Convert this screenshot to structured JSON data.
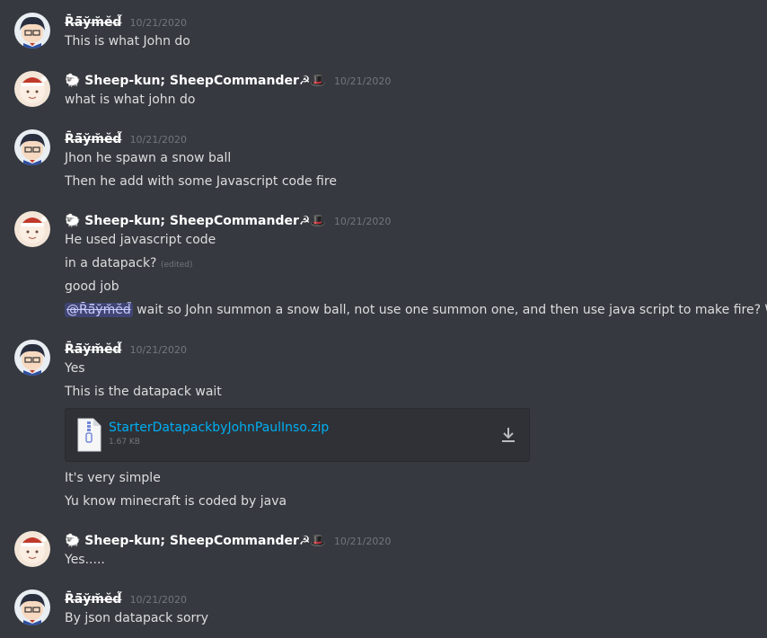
{
  "messages": [
    {
      "user": "R̄ä̃y̆m̆ĕd̃",
      "ts": "10/21/2020",
      "lines": [
        "This is what John do"
      ]
    },
    {
      "user": "🐑 Sheep-kun; SheepCommander☭🎩",
      "ts": "10/21/2020",
      "lines": [
        "what is what john do"
      ]
    },
    {
      "user": "R̄ä̃y̆m̆ĕd̃",
      "ts": "10/21/2020",
      "lines": [
        "Jhon he spawn a snow ball",
        "Then he add with some Javascript code fire"
      ]
    },
    {
      "user": "🐑 Sheep-kun; SheepCommander☭🎩",
      "ts": "10/21/2020",
      "lines": [
        "He used javascript code",
        "in a datapack?",
        "good job"
      ],
      "edited": "(edited)",
      "mention": "@R̄ä̃y̆m̆ĕd̃",
      "mention_text": " wait so John summon a snow ball, not use one summon one, and then use java script to make fire? What?"
    },
    {
      "user": "R̄ä̃y̆m̆ĕd̃",
      "ts": "10/21/2020",
      "lines": [
        "Yes",
        "This is the datapack wait",
        "It's very simple",
        "Yu know minecraft is coded by java"
      ],
      "attachment": {
        "name": "StarterDatapackbyJohnPaulInso.zip",
        "size": "1.67 KB"
      }
    },
    {
      "user": "🐑 Sheep-kun; SheepCommander☭🎩",
      "ts": "10/21/2020",
      "lines": [
        "Yes....."
      ]
    },
    {
      "user": "R̄ä̃y̆m̆ĕd̃",
      "ts": "10/21/2020",
      "lines": [
        "By json datapack sorry"
      ]
    }
  ]
}
